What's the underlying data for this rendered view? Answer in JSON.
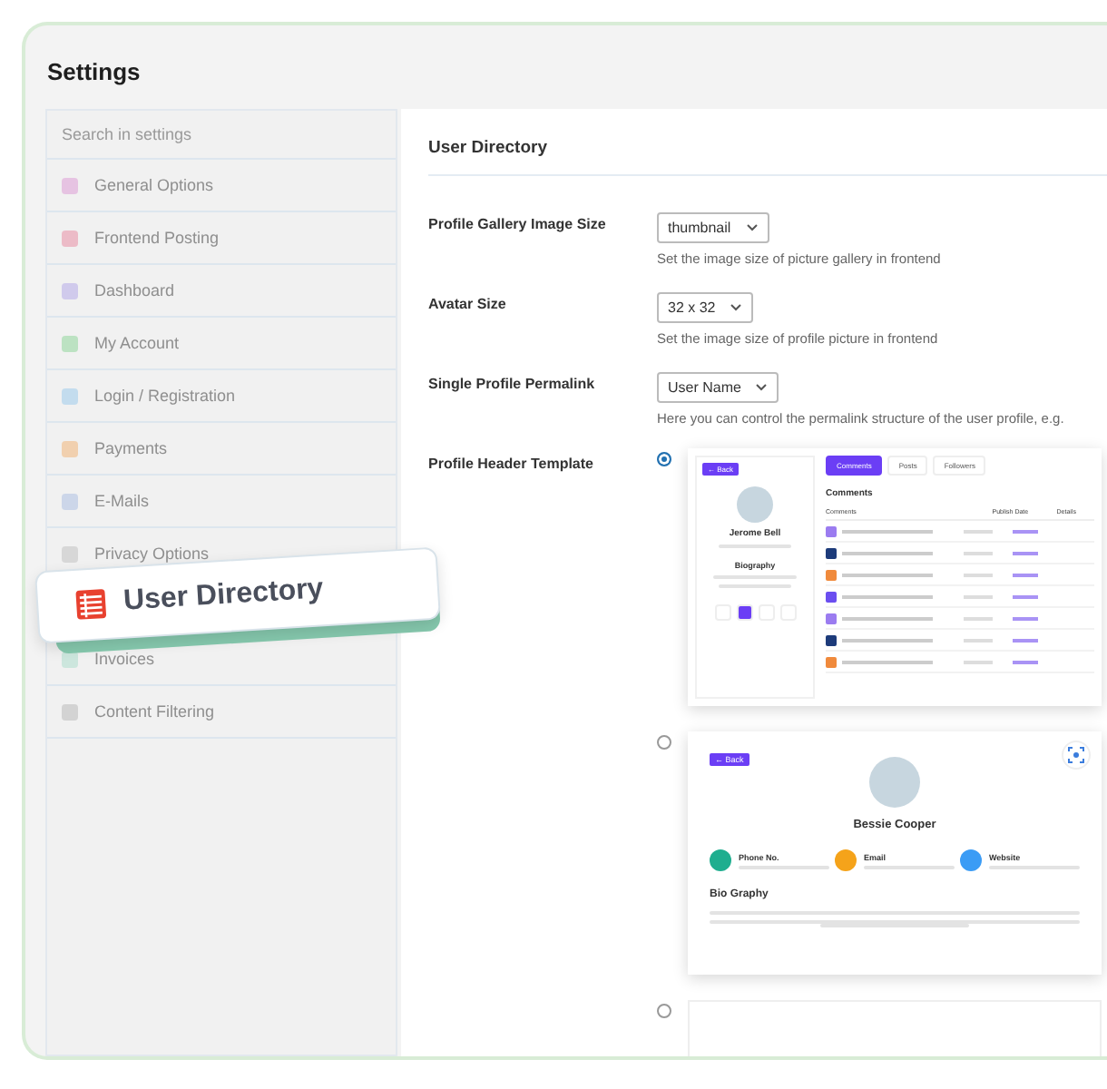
{
  "window": {
    "title": "Settings"
  },
  "sidebar": {
    "search": {
      "placeholder": "Search in settings"
    },
    "items": [
      {
        "label": "General Options",
        "selected": false
      },
      {
        "label": "Frontend Posting",
        "selected": false
      },
      {
        "label": "Dashboard",
        "selected": false
      },
      {
        "label": "My Account",
        "selected": false
      },
      {
        "label": "Login / Registration",
        "selected": false
      },
      {
        "label": "Payments",
        "selected": false
      },
      {
        "label": "E-Mails",
        "selected": false
      },
      {
        "label": "Privacy Options",
        "selected": false
      },
      {
        "label": "User Directory",
        "selected": true
      },
      {
        "label": "Invoices",
        "selected": false
      },
      {
        "label": "Content Filtering",
        "selected": false
      }
    ]
  },
  "content": {
    "title": "User Directory",
    "fields": [
      {
        "label": "Profile Gallery Image Size",
        "value": "thumbnail",
        "hint": "Set the image size of picture gallery in frontend"
      },
      {
        "label": "Avatar Size",
        "value": "32 x 32",
        "hint": "Set the image size of profile picture in frontend"
      },
      {
        "label": "Single Profile Permalink",
        "value": "User Name",
        "hint": "Here you can control the permalink structure of the user profile, e.g."
      }
    ],
    "template": {
      "label": "Profile Header Template",
      "options": [
        {
          "kind": "tabs",
          "selected": true,
          "back": "← Back",
          "name": "Jerome Bell",
          "bio_title": "Biography",
          "tabs": [
            {
              "label": "Comments",
              "selected": true
            },
            {
              "label": "Posts",
              "selected": false
            },
            {
              "label": "Followers",
              "selected": false
            }
          ],
          "heading": "Comments",
          "columns": [
            "Comments",
            "Publish Date",
            "Details"
          ]
        },
        {
          "kind": "contact",
          "selected": false,
          "back": "← Back",
          "name": "Bessie Cooper",
          "contacts": [
            {
              "label": "Phone No.",
              "color": "#1fae8f"
            },
            {
              "label": "Email",
              "color": "#f5a31a"
            },
            {
              "label": "Website",
              "color": "#3b9cf5"
            }
          ],
          "bio_title": "Bio Graphy"
        },
        {
          "kind": "blank",
          "selected": false
        }
      ]
    }
  }
}
